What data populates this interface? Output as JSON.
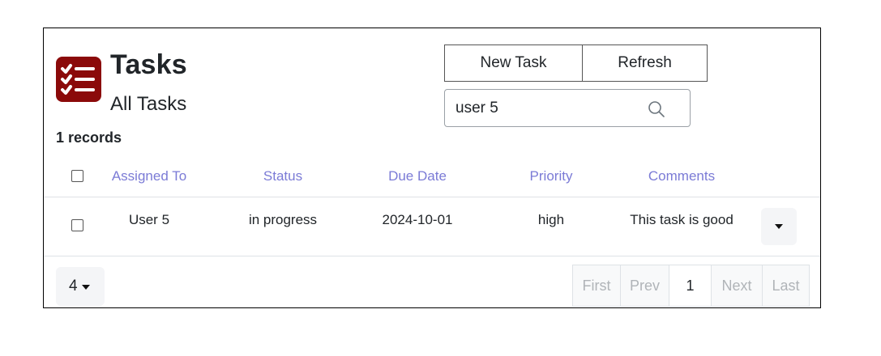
{
  "header": {
    "title": "Tasks",
    "subtitle": "All Tasks",
    "records": "1 records",
    "icon": "task-list-icon",
    "icon_color": "#8b0a0a"
  },
  "toolbar": {
    "new_label": "New Task",
    "refresh_label": "Refresh"
  },
  "search": {
    "value": "user 5",
    "icon": "search-icon"
  },
  "table": {
    "columns": [
      "Assigned To",
      "Status",
      "Due Date",
      "Priority",
      "Comments"
    ],
    "header_color": "#7b7bd6",
    "rows": [
      {
        "assigned_to": "User 5",
        "status": "in progress",
        "due_date": "2024-10-01",
        "priority": "high",
        "comments": "This task is good"
      }
    ]
  },
  "footer": {
    "page_size": "4",
    "pager": [
      "First",
      "Prev",
      "1",
      "Next",
      "Last"
    ]
  }
}
